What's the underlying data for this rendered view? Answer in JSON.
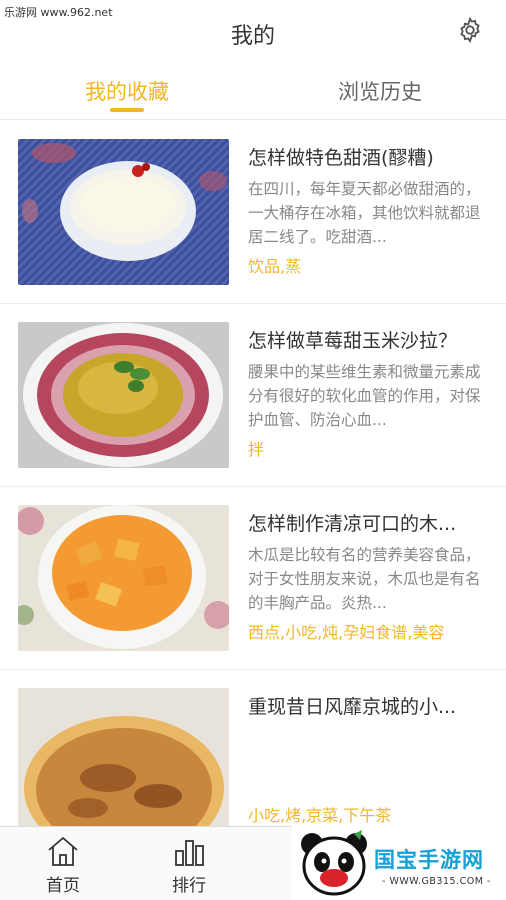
{
  "watermark_top": "乐游网 www.962.net",
  "header": {
    "title": "我的"
  },
  "tabs": [
    {
      "label": "我的收藏",
      "active": true
    },
    {
      "label": "浏览历史",
      "active": false
    }
  ],
  "items": [
    {
      "title": "怎样做特色甜酒(醪糟)",
      "desc": "在四川，每年夏天都必做甜酒的，一大桶存在冰箱，其他饮料就都退居二线了。吃甜酒...",
      "tags": "饮品,蒸"
    },
    {
      "title": "怎样做草莓甜玉米沙拉？",
      "desc": "腰果中的某些维生素和微量元素成分有很好的软化血管的作用，对保护血管、防治心血...",
      "tags": "拌"
    },
    {
      "title": "怎样制作清凉可口的木...",
      "desc": "木瓜是比较有名的营养美容食品，对于女性朋友来说，木瓜也是有名的丰胸产品。炎热...",
      "tags": "西点,小吃,炖,孕妇食谱,美容"
    },
    {
      "title": "重现昔日风靡京城的小...",
      "desc": "",
      "tags": "小吃,烤,京菜,下午茶"
    }
  ],
  "tabbar": {
    "home": "首页",
    "rank": "排行"
  },
  "brand": {
    "name": "国宝手游网",
    "url": "- WWW.GB315.COM -"
  },
  "colors": {
    "accent": "#f3b627",
    "brand_blue": "#16a0d6"
  }
}
